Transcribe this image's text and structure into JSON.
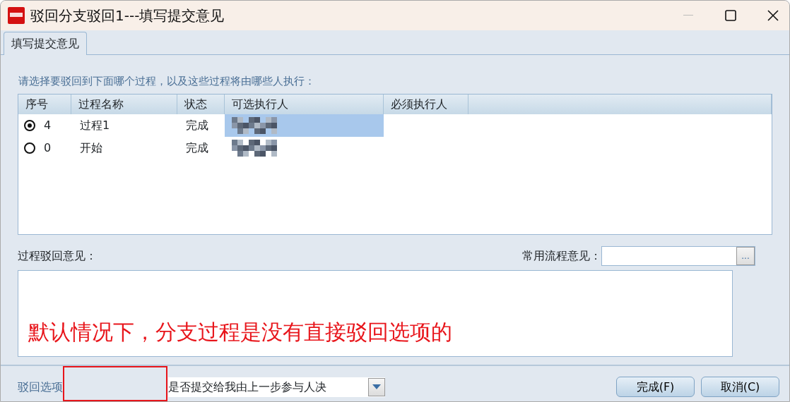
{
  "window": {
    "title": "驳回分支驳回1---填写提交意见"
  },
  "tabs": [
    {
      "label": "填写提交意见",
      "selected": true
    }
  ],
  "instruction": "请选择要驳回到下面哪个过程，以及这些过程将由哪些人执行：",
  "table": {
    "columns": [
      "序号",
      "过程名称",
      "状态",
      "可选执行人",
      "必须执行人"
    ],
    "rows": [
      {
        "selected": true,
        "number": "4",
        "name": "过程1",
        "status": "完成"
      },
      {
        "selected": false,
        "number": "0",
        "name": "开始",
        "status": "完成"
      }
    ]
  },
  "opinion_label": "过程驳回意见：",
  "common_opinion": {
    "label": "常用流程意见：",
    "button": "..."
  },
  "annotation": "默认情况下，分支过程是没有直接驳回选项的",
  "reject_option": {
    "label": "驳回选项",
    "value": "是否提交给我由上一步参与人决"
  },
  "buttons": [
    {
      "label": "完成(F)"
    },
    {
      "label": "取消(C)"
    }
  ]
}
